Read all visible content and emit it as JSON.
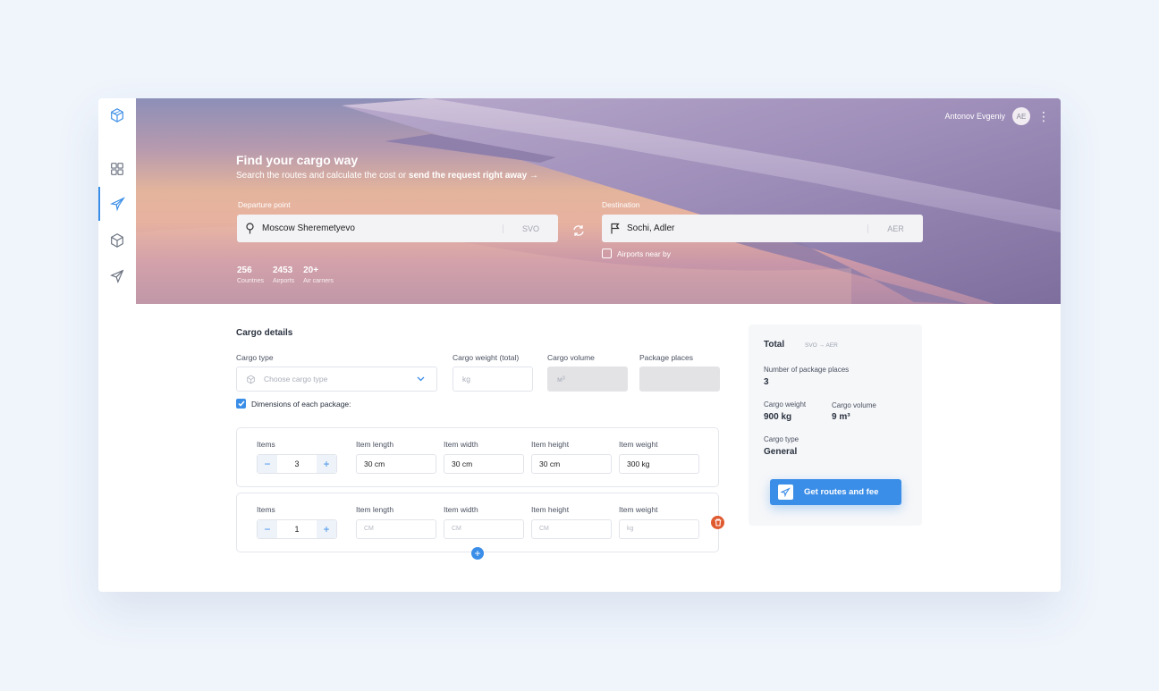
{
  "header": {
    "user_name": "Antonov Evgeniy",
    "user_initials": "AE",
    "title": "Find your cargo way",
    "subtitle": "Search the routes and calculate the cost or",
    "subtitle_link": "send the request right away →"
  },
  "sidebar": {
    "items": [
      {
        "icon": "dashboard-grid-icon"
      },
      {
        "icon": "plane-icon",
        "active": true
      },
      {
        "icon": "box-icon"
      },
      {
        "icon": "send-icon"
      }
    ]
  },
  "route": {
    "departure_label": "Departure point",
    "departure_value": "Moscow Sheremetyevo",
    "departure_code": "SVO",
    "destination_label": "Destination",
    "destination_value": "Sochi, Adler",
    "destination_code": "AER",
    "airports_near": "Airports near by"
  },
  "stats": [
    {
      "value": "256",
      "label": "Countries"
    },
    {
      "value": "2453",
      "label": "Airports"
    },
    {
      "value": "20+",
      "label": "Air carriers"
    }
  ],
  "cargo": {
    "title": "Cargo details",
    "type_label": "Cargo type",
    "type_placeholder": "Choose cargo type",
    "weight_label": "Cargo weight (total)",
    "weight_placeholder": "kg",
    "volume_label": "Cargo volume",
    "volume_placeholder": "м³",
    "places_label": "Package places",
    "dimensions_label": "Dimensions of each package:"
  },
  "packages": {
    "labels": {
      "items": "Items",
      "length": "Item length",
      "width": "Item width",
      "height": "Item height",
      "weight": "Item weight"
    },
    "rows": [
      {
        "items": "3",
        "length": "30 cm",
        "width": "30 cm",
        "height": "30 cm",
        "weight": "300 kg"
      },
      {
        "items": "1",
        "length": "CM",
        "width": "CM",
        "height": "CM",
        "weight": "kg"
      }
    ]
  },
  "summary": {
    "title": "Total",
    "route": "SVO → AER",
    "places_label": "Number of package places",
    "places_value": "3",
    "weight_label": "Cargo weight",
    "weight_value": "900 kg",
    "volume_label": "Cargo volume",
    "volume_value": "9 m³",
    "type_label": "Cargo type",
    "type_value": "General",
    "cta": "Get routes and fee"
  },
  "colors": {
    "accent": "#3b8ee8",
    "delete": "#e05a30"
  }
}
